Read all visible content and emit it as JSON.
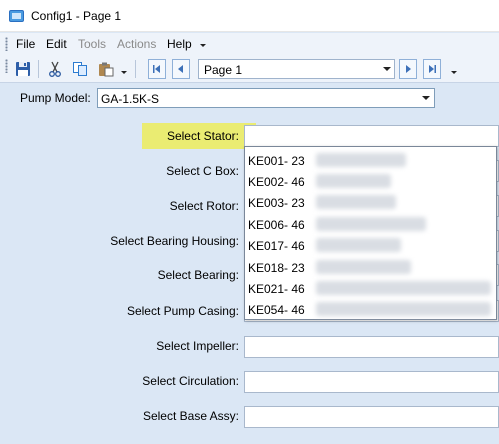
{
  "window": {
    "title": "Config1 - Page 1"
  },
  "menu": {
    "items": [
      {
        "label": "File",
        "enabled": true
      },
      {
        "label": "Edit",
        "enabled": true
      },
      {
        "label": "Tools",
        "enabled": false
      },
      {
        "label": "Actions",
        "enabled": false
      },
      {
        "label": "Help",
        "enabled": true
      }
    ]
  },
  "toolbar": {
    "icons": [
      "save-icon",
      "cut-icon",
      "copy-icon",
      "paste-icon"
    ],
    "page_selector": {
      "value": "Page 1"
    }
  },
  "form": {
    "pump_model": {
      "label": "Pump Model:",
      "value": "GA-1.5K-S"
    },
    "fields": [
      {
        "label": "Select Stator:",
        "value": ""
      },
      {
        "label": "Select C Box:",
        "value": ""
      },
      {
        "label": "Select Rotor:",
        "value": ""
      },
      {
        "label": "Select Bearing Housing:",
        "value": ""
      },
      {
        "label": "Select Bearing:",
        "value": ""
      },
      {
        "label": "Select Pump Casing:",
        "value": ""
      },
      {
        "label": "Select Impeller:",
        "value": ""
      },
      {
        "label": "Select Circulation:",
        "value": ""
      },
      {
        "label": "Select Base Assy:",
        "value": ""
      }
    ]
  },
  "stator_dropdown": {
    "items": [
      {
        "code": "KE001- 23"
      },
      {
        "code": "KE002- 46"
      },
      {
        "code": "KE003- 23"
      },
      {
        "code": "KE006- 46"
      },
      {
        "code": "KE017- 46"
      },
      {
        "code": "KE018- 23"
      },
      {
        "code": "KE021- 46"
      },
      {
        "code": "KE054- 46"
      }
    ]
  },
  "colors": {
    "form_background": "#dbe7f5",
    "highlight": "#ecec5a",
    "toolbar_background": "#eef3fa"
  }
}
